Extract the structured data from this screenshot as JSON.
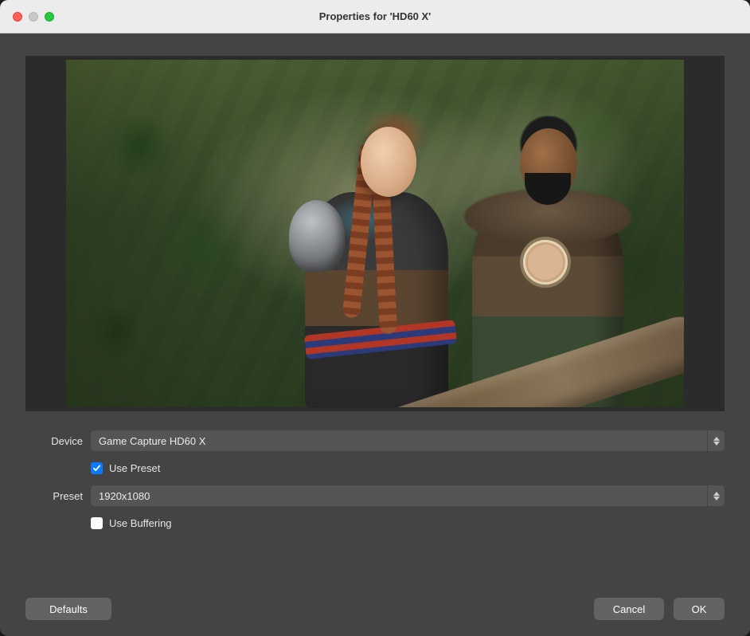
{
  "window": {
    "title": "Properties for 'HD60 X'"
  },
  "form": {
    "device": {
      "label": "Device",
      "value": "Game Capture HD60 X"
    },
    "use_preset": {
      "label": "Use Preset",
      "checked": true
    },
    "preset": {
      "label": "Preset",
      "value": "1920x1080"
    },
    "use_buffering": {
      "label": "Use Buffering",
      "checked": false
    }
  },
  "buttons": {
    "defaults": "Defaults",
    "cancel": "Cancel",
    "ok": "OK"
  }
}
